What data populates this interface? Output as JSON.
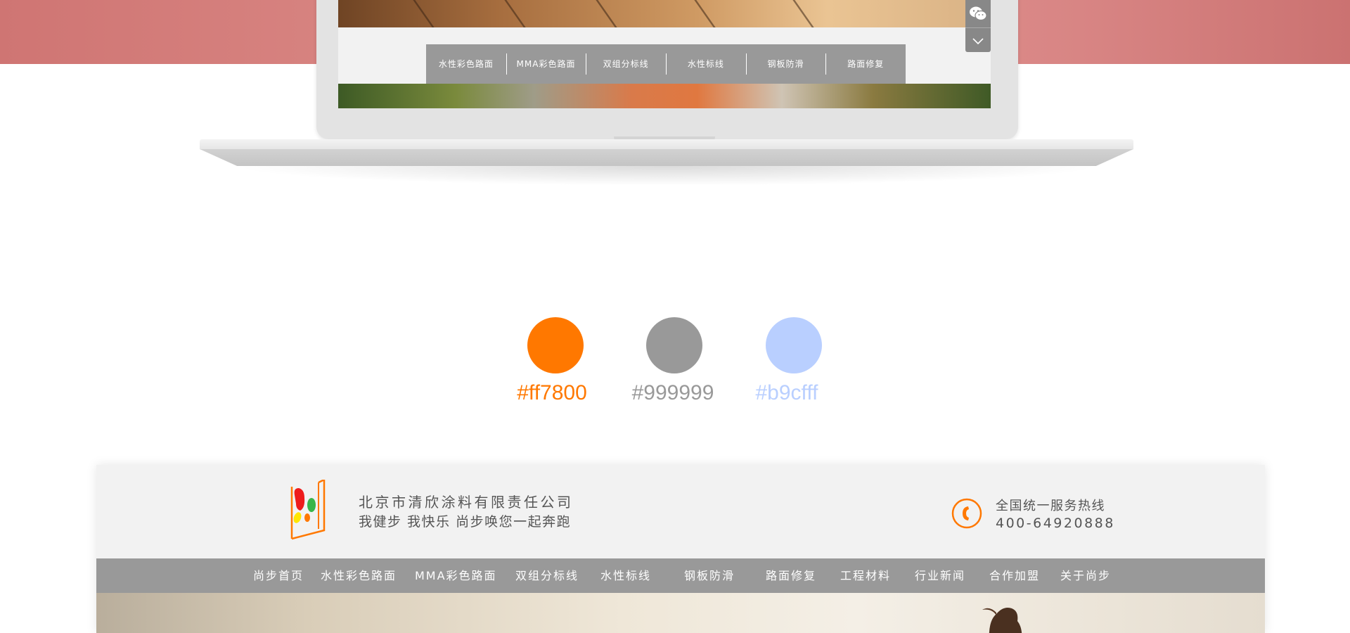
{
  "laptop_preview": {
    "nav_items": [
      "水性彩色路面",
      "MMA彩色路面",
      "双组分标线",
      "水性标线",
      "钢板防滑",
      "路面修复"
    ],
    "side_widget": {
      "top_icon": "wechat-icon",
      "bottom_icon": "chevron-down-icon"
    }
  },
  "palette": {
    "colors": [
      {
        "hex": "#ff7800",
        "label": "#ff7800"
      },
      {
        "hex": "#999999",
        "label": "#999999"
      },
      {
        "hex": "#b9cfff",
        "label": "#b9cfff"
      }
    ]
  },
  "site_header": {
    "logo_icon": "brand-logo-icon",
    "company_name": "北京市清欣涂料有限责任公司",
    "slogan": "我健步 我快乐 尚步唤您一起奔跑",
    "hotline_icon": "phone-icon",
    "hotline_label": "全国统一服务热线",
    "hotline_number": "400-64920888",
    "accent_color": "#ff7800"
  },
  "main_nav": {
    "items": [
      "尚步首页",
      "水性彩色路面",
      "MMA彩色路面",
      "双组分标线",
      "水性标线",
      "钢板防滑",
      "路面修复",
      "工程材料",
      "行业新闻",
      "合作加盟",
      "关于尚步"
    ]
  }
}
